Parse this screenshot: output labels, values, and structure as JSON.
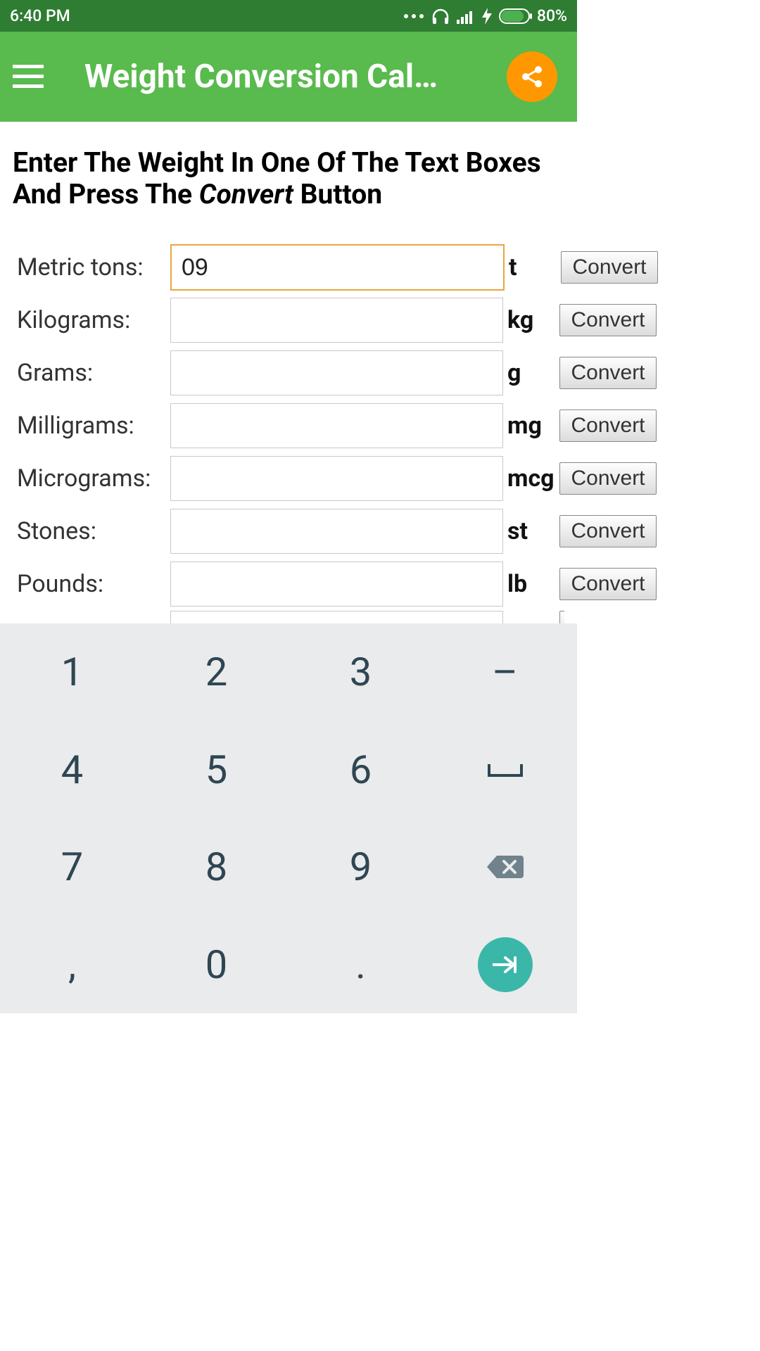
{
  "status": {
    "time": "6:40 PM",
    "battery_pct": "80%"
  },
  "header": {
    "title": "Weight Conversion Cal…"
  },
  "instruction": {
    "prefix": "Enter The Weight In One Of The Text Boxes And Press The ",
    "convert_word": "Convert",
    "suffix": " Button"
  },
  "convert_label": "Convert",
  "rows": [
    {
      "label": "Metric tons:",
      "value": "09",
      "unit": "t",
      "active": true
    },
    {
      "label": "Kilograms:",
      "value": "",
      "unit": "kg"
    },
    {
      "label": "Grams:",
      "value": "",
      "unit": "g"
    },
    {
      "label": "Milligrams:",
      "value": "",
      "unit": "mg"
    },
    {
      "label": "Micrograms:",
      "value": "",
      "unit": "mcg"
    },
    {
      "label": "Stones:",
      "value": "",
      "unit": "st"
    },
    {
      "label": "Pounds:",
      "value": "",
      "unit": "lb"
    }
  ],
  "keyboard": {
    "rows": [
      [
        "1",
        "2",
        "3",
        "–"
      ],
      [
        "4",
        "5",
        "6",
        "␣"
      ],
      [
        "7",
        "8",
        "9",
        "⌫"
      ],
      [
        ",",
        "0",
        ".",
        "↵"
      ]
    ]
  }
}
